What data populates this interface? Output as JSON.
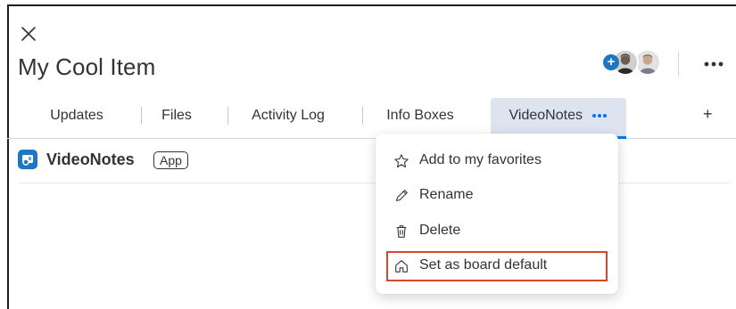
{
  "item": {
    "title": "My Cool Item"
  },
  "tabs": [
    {
      "label": "Updates"
    },
    {
      "label": "Files"
    },
    {
      "label": "Activity Log"
    },
    {
      "label": "Info Boxes"
    },
    {
      "label": "VideoNotes",
      "active": true
    }
  ],
  "tab_add_label": "+",
  "app": {
    "name": "VideoNotes",
    "badge": "App"
  },
  "menu": {
    "items": [
      {
        "label": "Add to my favorites",
        "icon": "star-icon"
      },
      {
        "label": "Rename",
        "icon": "pencil-icon"
      },
      {
        "label": "Delete",
        "icon": "trash-icon"
      },
      {
        "label": "Set as board default",
        "icon": "home-icon",
        "highlighted": true
      }
    ]
  },
  "colors": {
    "accent": "#0073ea",
    "highlight_border": "#d9472b",
    "active_tab_bg": "#dde3ef",
    "plus_badge": "#1f76c2"
  },
  "avatars": {
    "count": 2,
    "add_badge": "+"
  }
}
